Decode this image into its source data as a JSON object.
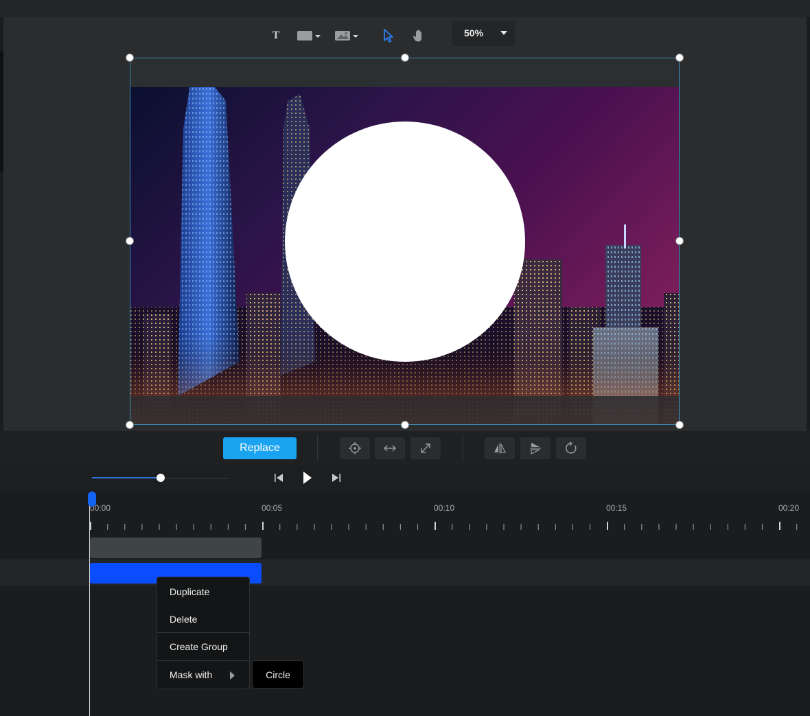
{
  "toolbar": {
    "tools": [
      {
        "name": "text-tool",
        "icon": "text-T-icon",
        "glyph": "T"
      },
      {
        "name": "shape-tool",
        "icon": "rectangle-icon"
      },
      {
        "name": "image-tool",
        "icon": "image-icon"
      },
      {
        "name": "select-tool",
        "icon": "cursor-arrow-icon",
        "active": true
      },
      {
        "name": "pan-tool",
        "icon": "hand-icon"
      }
    ],
    "zoom": "50%"
  },
  "canvas": {
    "image": "city-skyline-night",
    "overlay_shape": "circle",
    "accent_color": "#3a8fb6"
  },
  "actions": {
    "replace_label": "Replace",
    "icons": [
      "crosshair-icon",
      "fit-width-icon",
      "expand-icon",
      "flip-horizontal-icon",
      "flip-vertical-icon",
      "rotate-icon"
    ],
    "replace_color": "#1aa3f0"
  },
  "playback": {
    "progress": 0.5,
    "icons": [
      "skip-start-icon",
      "play-icon",
      "skip-end-icon"
    ]
  },
  "timeline": {
    "labels": [
      "00:00",
      "00:05",
      "00:10",
      "00:15",
      "00:20"
    ],
    "track_color": "#0a4dff"
  },
  "context_menu": {
    "items": [
      "Duplicate",
      "Delete",
      "Create Group",
      "Mask with"
    ],
    "submenu": [
      "Circle"
    ]
  }
}
